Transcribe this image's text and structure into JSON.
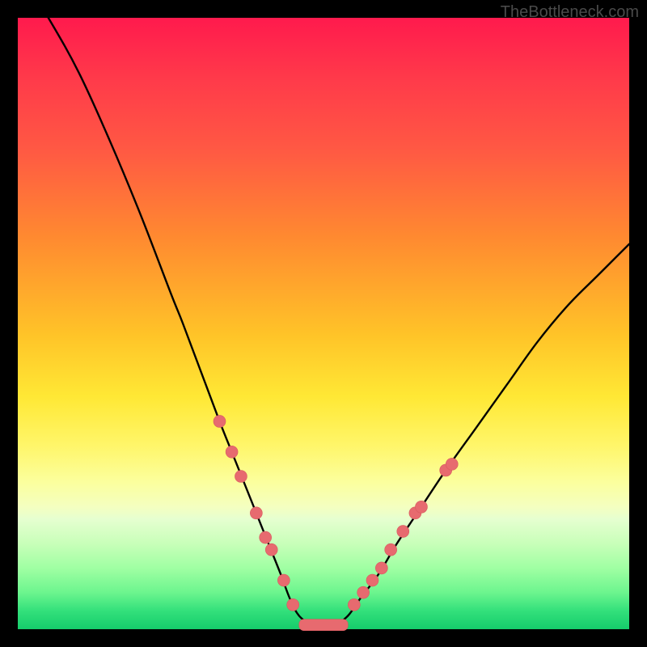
{
  "watermark": "TheBottleneck.com",
  "colors": {
    "bg": "#000000",
    "dot": "#e76a6f",
    "curve": "#000000"
  },
  "chart_data": {
    "type": "line",
    "title": "",
    "xlabel": "",
    "ylabel": "",
    "xlim": [
      0,
      100
    ],
    "ylim": [
      0,
      100
    ],
    "grid": false,
    "legend": false,
    "series": [
      {
        "name": "bottleneck-curve",
        "x": [
          0,
          5,
          10,
          15,
          20,
          25,
          27,
          30,
          33,
          35,
          37,
          39,
          41,
          43,
          44.5,
          46,
          48,
          50,
          52,
          54,
          56,
          59,
          62,
          66,
          70,
          75,
          80,
          85,
          90,
          95,
          100
        ],
        "y": [
          108,
          100,
          91,
          80,
          68,
          55,
          50,
          42,
          34,
          29,
          24,
          19,
          14,
          9,
          5,
          2.2,
          0.8,
          0.6,
          0.8,
          2.2,
          5,
          9,
          14,
          20,
          26,
          33,
          40,
          47,
          53,
          58,
          63
        ]
      }
    ],
    "markers": {
      "name": "highlight-dots",
      "points": [
        {
          "x": 33.0,
          "y": 34
        },
        {
          "x": 35.0,
          "y": 29
        },
        {
          "x": 36.5,
          "y": 25
        },
        {
          "x": 39.0,
          "y": 19
        },
        {
          "x": 40.5,
          "y": 15
        },
        {
          "x": 41.5,
          "y": 13
        },
        {
          "x": 43.5,
          "y": 8
        },
        {
          "x": 45.0,
          "y": 4
        },
        {
          "x": 55.0,
          "y": 4
        },
        {
          "x": 56.5,
          "y": 6
        },
        {
          "x": 58.0,
          "y": 8
        },
        {
          "x": 59.5,
          "y": 10
        },
        {
          "x": 61.0,
          "y": 13
        },
        {
          "x": 63.0,
          "y": 16
        },
        {
          "x": 65.0,
          "y": 19
        },
        {
          "x": 66.0,
          "y": 20
        },
        {
          "x": 70.0,
          "y": 26
        },
        {
          "x": 71.0,
          "y": 27
        }
      ]
    },
    "plateau": {
      "x_start": 46,
      "x_end": 54,
      "y": 0.7
    }
  }
}
